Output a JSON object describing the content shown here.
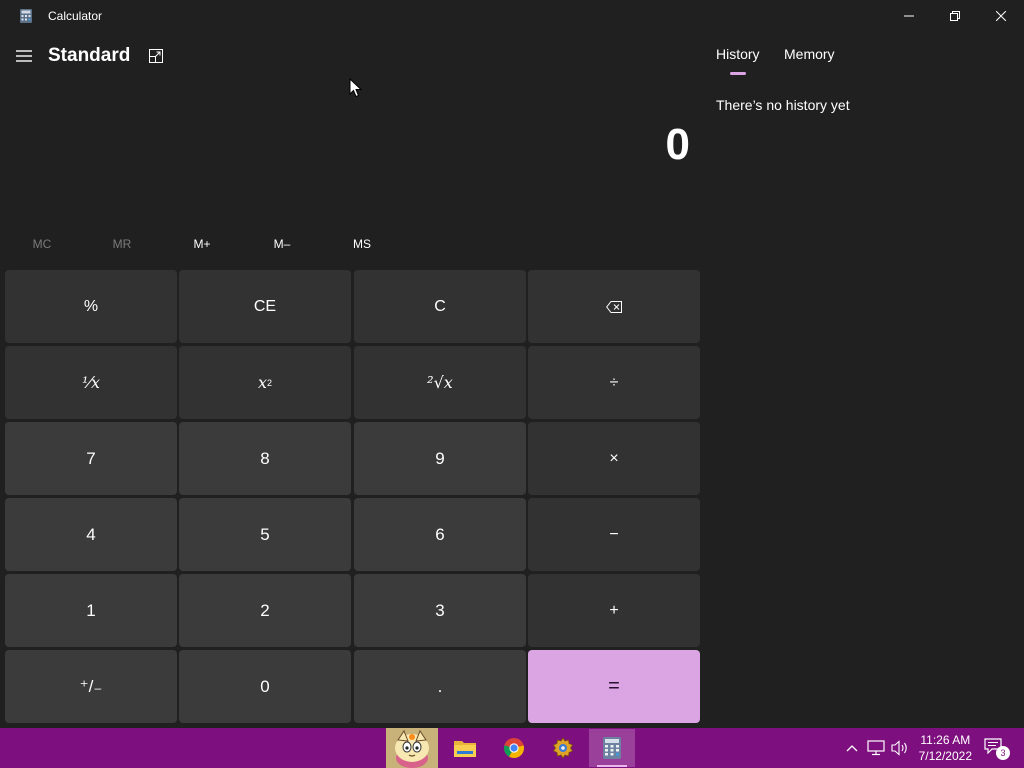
{
  "titlebar": {
    "title": "Calculator",
    "icon": "calculator-icon",
    "minimize_icon": "minimize-icon",
    "restore_icon": "restore-icon",
    "close_icon": "close-icon"
  },
  "header": {
    "menu_icon": "hamburger-icon",
    "mode": "Standard",
    "keep_on_top_icon": "keep-on-top-icon"
  },
  "display": {
    "value": "0"
  },
  "memory": {
    "mc": "MC",
    "mr": "MR",
    "mplus": "M+",
    "mminus": "M–",
    "ms": "MS"
  },
  "keys": {
    "percent": "%",
    "ce": "CE",
    "c": "C",
    "backspace_icon": "backspace-icon",
    "reciprocal": "⅟x",
    "square": "x",
    "square_sup": "2",
    "sqrt": "²√x",
    "divide": "÷",
    "seven": "7",
    "eight": "8",
    "nine": "9",
    "multiply": "×",
    "four": "4",
    "five": "5",
    "six": "6",
    "minus": "−",
    "one": "1",
    "two": "2",
    "three": "3",
    "plus": "+",
    "negate": "⁺/₋",
    "zero": "0",
    "decimal": ".",
    "equals": "="
  },
  "history": {
    "tab_history": "History",
    "tab_memory": "Memory",
    "empty_text": "There’s no history yet"
  },
  "taskbar": {
    "apps": [
      "game-icon",
      "file-explorer-icon",
      "chrome-icon",
      "settings-app-icon",
      "calculator-icon"
    ],
    "time": "11:26 AM",
    "date": "7/12/2022",
    "notification_count": "3"
  },
  "colors": {
    "background": "#202020",
    "key": "#3b3b3b",
    "accent": "#dba5e3",
    "taskbar": "#7e0f7e"
  }
}
